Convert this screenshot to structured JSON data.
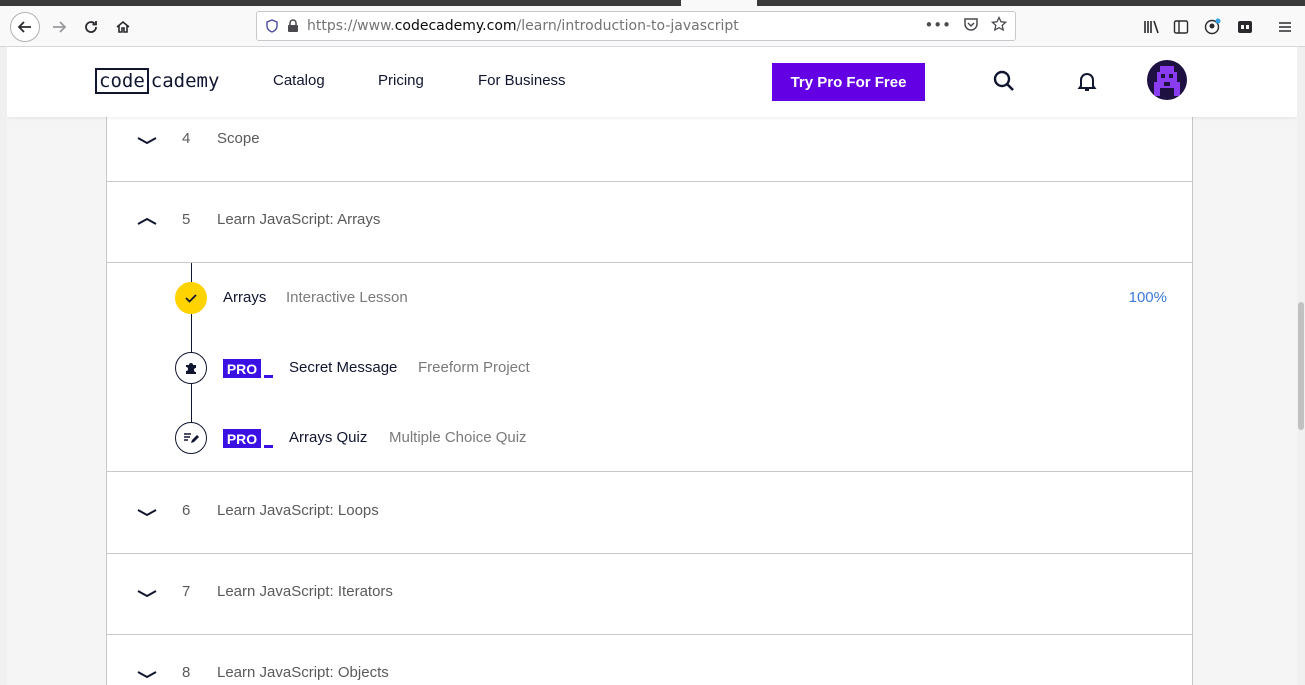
{
  "browser": {
    "url_prefix": "https://www.",
    "url_host": "codecademy.com",
    "url_path": "/learn/introduction-to-javascript"
  },
  "header": {
    "logo_boxed": "code",
    "logo_rest": "cademy",
    "nav": [
      "Catalog",
      "Pricing",
      "For Business"
    ],
    "cta": "Try Pro For Free",
    "accent_color": "#6400e4"
  },
  "modules_before": [
    {
      "number": "4",
      "title": "Scope",
      "expanded": false
    },
    {
      "number": "5",
      "title": "Learn JavaScript: Arrays",
      "expanded": true
    }
  ],
  "lessons": [
    {
      "name": "Arrays",
      "type": "Interactive Lesson",
      "pro": false,
      "icon": "check-icon",
      "progress": "100%",
      "completed": true
    },
    {
      "name": "Secret Message",
      "type": "Freeform Project",
      "pro": true,
      "pro_label": "PRO",
      "icon": "puzzle-icon"
    },
    {
      "name": "Arrays Quiz",
      "type": "Multiple Choice Quiz",
      "pro": true,
      "pro_label": "PRO",
      "icon": "quiz-icon"
    }
  ],
  "modules_after": [
    {
      "number": "6",
      "title": "Learn JavaScript: Loops",
      "expanded": false
    },
    {
      "number": "7",
      "title": "Learn JavaScript: Iterators",
      "expanded": false
    },
    {
      "number": "8",
      "title": "Learn JavaScript: Objects",
      "expanded": false
    }
  ]
}
